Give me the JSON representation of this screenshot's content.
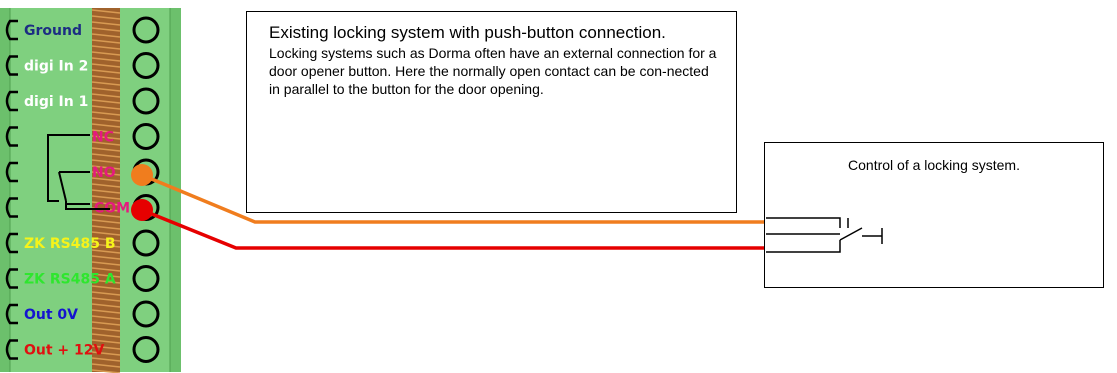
{
  "terminal_block": {
    "terminals": [
      {
        "label": "Ground",
        "color": "#1c2d83"
      },
      {
        "label": "digi In 2",
        "color": "#ffffff"
      },
      {
        "label": "digi In 1",
        "color": "#ffffff"
      },
      {
        "label": "NC",
        "color": "#e6197f"
      },
      {
        "label": "NO",
        "color": "#e6197f"
      },
      {
        "label": "COM",
        "color": "#e6197f"
      },
      {
        "label": "ZK RS485 B",
        "color": "#f6f31a"
      },
      {
        "label": "ZK RS485 A",
        "color": "#2ee62e"
      },
      {
        "label": "Out 0V",
        "color": "#1414d0"
      },
      {
        "label": "Out + 12V",
        "color": "#e01010"
      }
    ],
    "body_color": "#7fd07f"
  },
  "callout": {
    "title": "Existing locking system with push-button connection.",
    "body": "Locking systems such as Dorma often have an external connection for a door opener button. Here the normally open contact can be con-nected in parallel to the button for the door opening."
  },
  "lock_box": {
    "title": "Control of a locking system."
  },
  "wires": {
    "no_wire_color": "#f07d1e",
    "com_wire_color": "#e60000"
  }
}
